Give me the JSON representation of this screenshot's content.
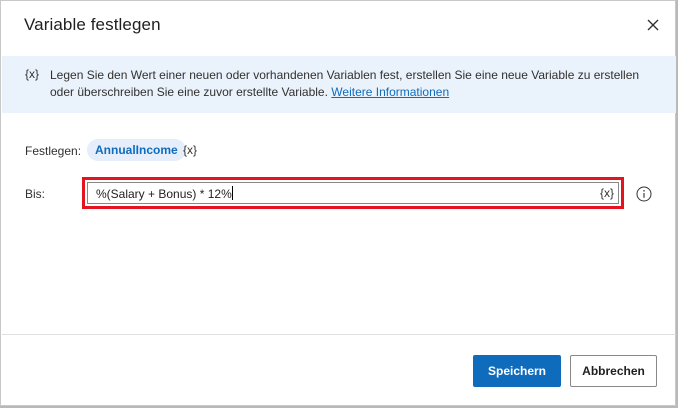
{
  "dialog": {
    "title": "Variable festlegen",
    "close_icon": "close-icon"
  },
  "info": {
    "icon_text": "{x}",
    "text": "Legen Sie den Wert einer neuen oder vorhandenen Variablen fest, erstellen Sie eine neue Variable zu erstellen oder überschreiben Sie eine zuvor erstellte Variable. ",
    "link_text": "Weitere Informationen"
  },
  "form": {
    "set_label": "Festlegen:",
    "variable_name": "AnnualIncome",
    "variable_icon": "{x}",
    "to_label": "Bis:",
    "to_value": "%(Salary + Bonus) * 12%",
    "input_var_icon": "{x}",
    "help_icon": "info-icon"
  },
  "buttons": {
    "save": "Speichern",
    "cancel": "Abbrechen"
  },
  "colors": {
    "accent": "#0f6cbd",
    "highlight": "#e3131f",
    "info_bg": "#eaf2fb"
  }
}
